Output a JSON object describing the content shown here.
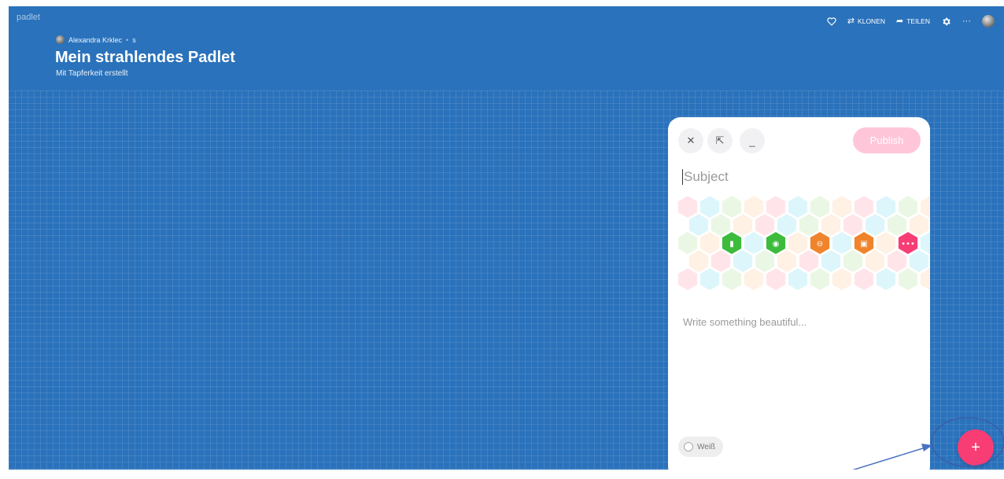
{
  "app": {
    "logo": "padlet"
  },
  "header": {
    "author": "Alexandra Krklec",
    "author_suffix": "s",
    "title": "Mein strahlendes Padlet",
    "subtitle": "Mit Tapferkeit erstellt"
  },
  "toolbar": {
    "like_icon": "heart-icon",
    "clone_label": "KLONEN",
    "share_label": "TEILEN",
    "settings_icon": "gear-icon",
    "more_icon": "ellipsis-icon"
  },
  "composer": {
    "close_icon": "close-icon",
    "expand_icon": "expand-arrow-icon",
    "minimize_icon": "minimize-icon",
    "publish_label": "Publish",
    "subject_placeholder": "Subject",
    "body_placeholder": "Write something beautiful...",
    "color_label": "Weiß",
    "attachments": [
      {
        "name": "upload-file-icon",
        "color": "#3dbb3d"
      },
      {
        "name": "camera-icon",
        "color": "#3dbb3d"
      },
      {
        "name": "link-icon",
        "color": "#f0842c"
      },
      {
        "name": "image-search-icon",
        "color": "#f0842c"
      },
      {
        "name": "more-attachments-icon",
        "color": "#f83d75"
      }
    ]
  },
  "fab": {
    "icon": "plus-icon"
  },
  "colors": {
    "background": "#2a72bb",
    "accent_pink": "#f83d75",
    "publish_disabled": "#ffc6d9",
    "annotation": "#3b5ea8"
  }
}
